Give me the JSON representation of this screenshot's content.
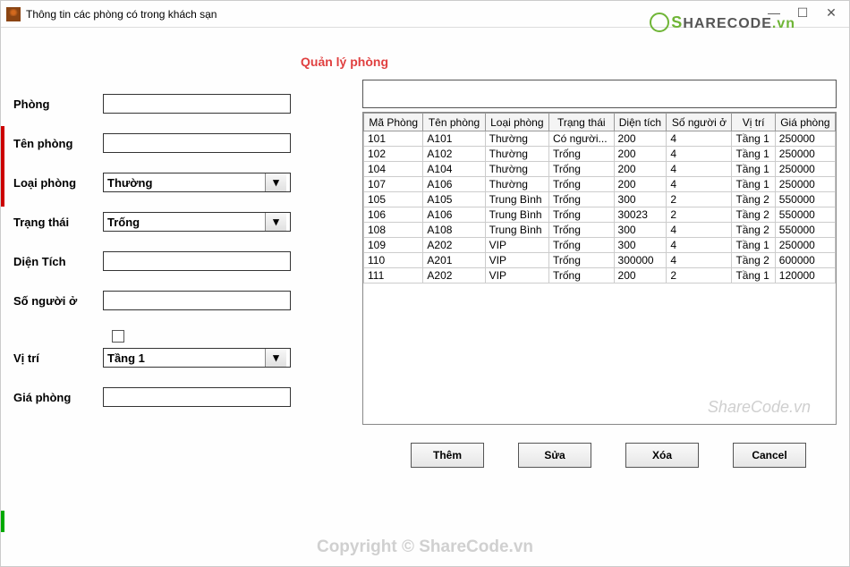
{
  "window": {
    "title": "Thông tin các phòng có trong khách sạn"
  },
  "page_title": "Quản lý phòng",
  "form": {
    "labels": {
      "phong": "Phòng",
      "ten_phong": "Tên phòng",
      "loai_phong": "Loại phòng",
      "trang_thai": "Trạng thái",
      "dien_tich": "Diện Tích",
      "so_nguoi_o": "Số người ở",
      "vi_tri": "Vị trí",
      "gia_phong": "Giá phòng"
    },
    "values": {
      "phong": "",
      "ten_phong": "",
      "loai_phong": "Thường",
      "trang_thai": "Trống",
      "dien_tich": "",
      "so_nguoi_o": "",
      "vi_tri": "Tầng 1",
      "gia_phong": ""
    }
  },
  "search_value": "",
  "table": {
    "headers": [
      "Mã Phòng",
      "Tên phòng",
      "Loại phòng",
      "Trạng thái",
      "Diện tích",
      "Số người ở",
      "Vị trí",
      "Giá phòng"
    ],
    "rows": [
      [
        "101",
        "A101",
        "Thường",
        "Có người...",
        "200",
        "4",
        "Tầng 1",
        "250000"
      ],
      [
        "102",
        "A102",
        "Thường",
        "Trống",
        "200",
        "4",
        "Tầng 1",
        "250000"
      ],
      [
        "104",
        "A104",
        "Thường",
        "Trống",
        "200",
        "4",
        "Tầng 1",
        "250000"
      ],
      [
        "107",
        "A106",
        "Thường",
        "Trống",
        "200",
        "4",
        "Tầng 1",
        "250000"
      ],
      [
        "105",
        "A105",
        "Trung Bình",
        "Trống",
        "300",
        "2",
        "Tầng 2",
        "550000"
      ],
      [
        "106",
        "A106",
        "Trung Bình",
        "Trống",
        "30023",
        "2",
        "Tầng 2",
        "550000"
      ],
      [
        "108",
        "A108",
        "Trung Bình",
        "Trống",
        "300",
        "4",
        "Tầng 2",
        "550000"
      ],
      [
        "109",
        "A202",
        "VIP",
        "Trống",
        "300",
        "4",
        "Tầng 1",
        "250000"
      ],
      [
        "110",
        "A201",
        "VIP",
        "Trống",
        "300000",
        "4",
        "Tầng 2",
        "600000"
      ],
      [
        "111",
        "A202",
        "VIP",
        "Trống",
        "200",
        "2",
        "Tầng 1",
        "120000"
      ]
    ]
  },
  "buttons": {
    "them": "Thêm",
    "sua": "Sửa",
    "xoa": "Xóa",
    "cancel": "Cancel"
  },
  "watermarks": {
    "logo": "SHARECODE.vn",
    "center": "ShareCode.vn",
    "copyright": "Copyright © ShareCode.vn"
  }
}
